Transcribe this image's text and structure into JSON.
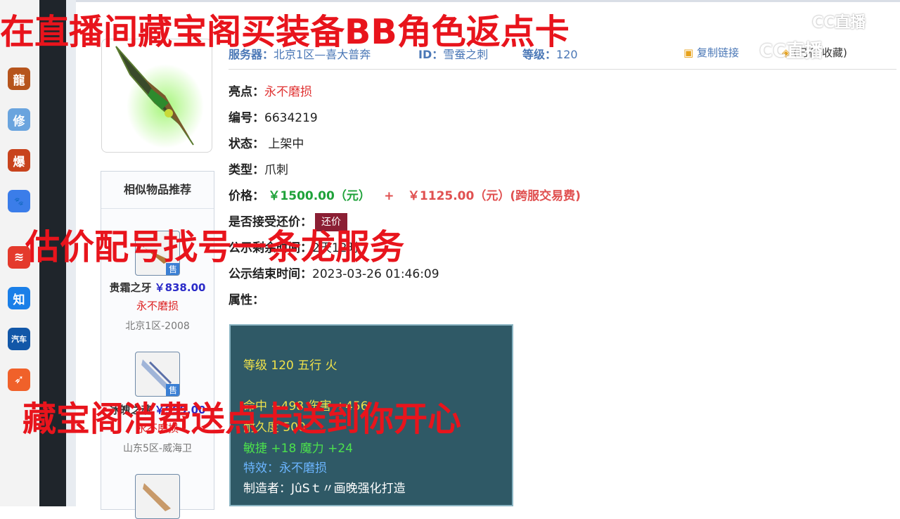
{
  "dock": {
    "items": [
      {
        "name": "dragon-game-icon",
        "glyph": "龍",
        "color": "#b6541c"
      },
      {
        "name": "xiuxian-game-icon",
        "glyph": "修",
        "color": "#6aa4de"
      },
      {
        "name": "bao-game-icon",
        "glyph": "爆",
        "color": "#c8431d"
      },
      {
        "name": "baidu-icon",
        "glyph": "🐾",
        "color": "#3b7de9"
      },
      {
        "name": "swallow-app-icon",
        "glyph": "≋",
        "color": "#e43a2c"
      },
      {
        "name": "zhihu-icon",
        "glyph": "知",
        "color": "#1a7fe8"
      },
      {
        "name": "car-app-icon",
        "glyph": "汽车",
        "color": "#1257a8"
      },
      {
        "name": "arrow-app-icon",
        "glyph": "➶",
        "color": "#f0612a"
      }
    ]
  },
  "header": {
    "server_label": "服务器：",
    "server_value": "北京1区—喜大普奔",
    "id_label": "ID：",
    "id_value": "雪蚕之刺",
    "level_label": "等级：",
    "level_value": "120",
    "copy_link": "复制链接",
    "favorite": "(已有",
    "favorite_count": "收藏)"
  },
  "details": {
    "highlight_label": "亮点：",
    "highlight_value": "永不磨损",
    "number_label": "编号：",
    "number_value": "6634219",
    "status_label": "状态：",
    "status_value": "上架中",
    "type_label": "类型：",
    "type_value": "爪刺",
    "price_label": "价格：",
    "price_value": "￥1500.00（元）",
    "plus": "+",
    "fee_value": "￥1125.00（元）",
    "fee_note": "(跨服交易费)",
    "bargain_label": "是否接受还价：",
    "bargain_button": "还价",
    "remaining_label": "公示剩余时间：",
    "remaining_value": "2天12时",
    "end_label": "公示结束时间：",
    "end_value": "2023-03-26 01:46:09",
    "attr_label": "属性："
  },
  "recommend": {
    "title": "相似物品推荐",
    "sell_tag": "售",
    "items": [
      {
        "name": "贵霜之牙",
        "price": "￥838.00",
        "attr": "永不磨损",
        "server": "北京1区-2008"
      },
      {
        "name": "冰魄之魂",
        "price": "￥999.00",
        "attr": "永不磨损",
        "server": "山东5区-威海卫"
      },
      {
        "name": "",
        "price": "",
        "attr": "",
        "server": ""
      }
    ]
  },
  "attributes": {
    "line1": "等级 120 五行 火",
    "line2": "命中 +498 伤害 +456",
    "line3": "耐久度 500",
    "line4": "敏捷 +18 魔力 +24",
    "line5": "特效：永不磨损",
    "line6": "制造者：JûSｔ〃画晚强化打造"
  },
  "overlays": {
    "top": "在直播间藏宝阁买装备BB角色返点卡",
    "middle": "估价配号找号一条龙服务",
    "bottom": "藏宝阁消费送点卡送到你开心"
  },
  "watermark": {
    "top": "CC直播",
    "second": "CC直播"
  }
}
